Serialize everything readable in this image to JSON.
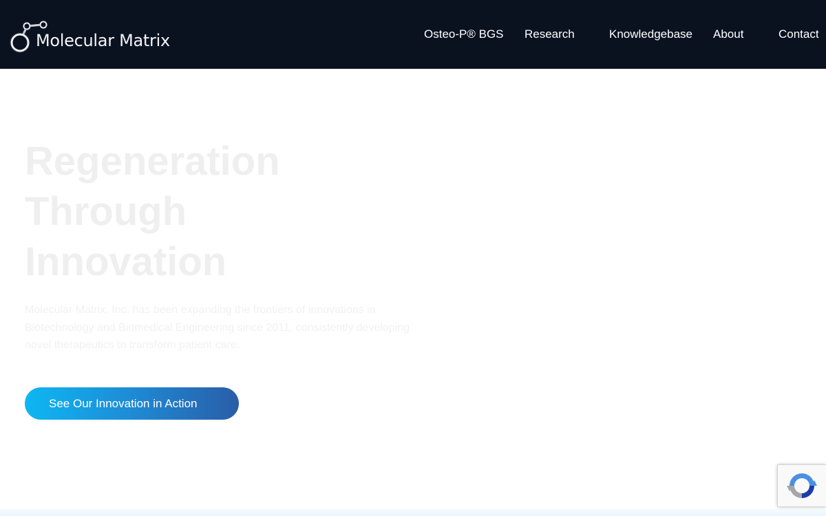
{
  "brand": {
    "name": "Molecular Matrix",
    "colors": {
      "header_bg": "#0a1220",
      "accent_start": "#0db7f2",
      "accent_end": "#2a5da8"
    }
  },
  "nav": {
    "items": [
      {
        "label": "Osteo-P® BGS"
      },
      {
        "label": "Research"
      },
      {
        "label": "Knowledgebase"
      },
      {
        "label": "About"
      },
      {
        "label": "Contact"
      }
    ]
  },
  "hero": {
    "title_lines": [
      "Regeneration",
      "Through",
      "Innovation"
    ],
    "description": "Molecular Matrix, Inc. has been expanding the frontiers of innovations in Biotechnology and Biomedical Engineering since 2011, consistently developing novel therapeutics to transform patient care.",
    "cta_label": "See Our Innovation in Action"
  },
  "recaptcha": {
    "icon": "recaptcha-icon"
  }
}
